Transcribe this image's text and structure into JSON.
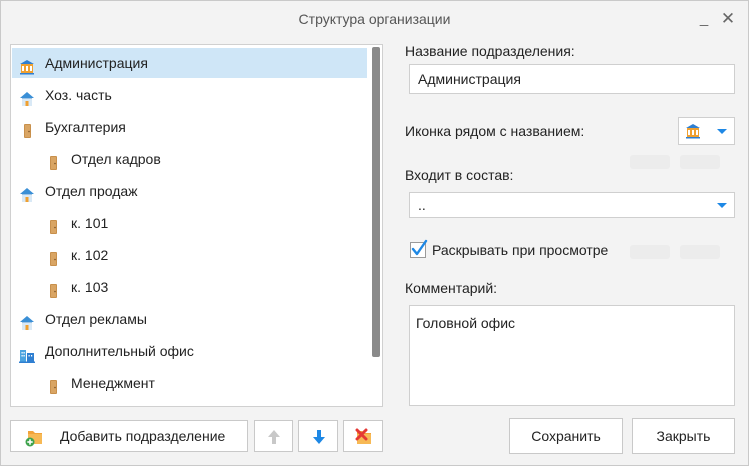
{
  "window": {
    "title": "Структура организации",
    "minimize_glyph": "_",
    "close_glyph": "✕"
  },
  "tree": {
    "items": [
      {
        "label": "Администрация",
        "icon": "building-icon",
        "level": 0,
        "selected": true
      },
      {
        "label": "Хоз. часть",
        "icon": "house-icon",
        "level": 0,
        "selected": false
      },
      {
        "label": "Бухгалтерия",
        "icon": "door-icon",
        "level": 0,
        "selected": false
      },
      {
        "label": "Отдел кадров",
        "icon": "door-icon",
        "level": 1,
        "selected": false
      },
      {
        "label": "Отдел продаж",
        "icon": "house-icon",
        "level": 0,
        "selected": false
      },
      {
        "label": "к. 101",
        "icon": "door-icon",
        "level": 1,
        "selected": false
      },
      {
        "label": "к. 102",
        "icon": "door-icon",
        "level": 1,
        "selected": false
      },
      {
        "label": "к. 103",
        "icon": "door-icon",
        "level": 1,
        "selected": false
      },
      {
        "label": "Отдел рекламы",
        "icon": "house-icon",
        "level": 0,
        "selected": false
      },
      {
        "label": "Дополнительный офис",
        "icon": "office-towers-icon",
        "level": 0,
        "selected": false
      },
      {
        "label": "Менеджмент",
        "icon": "door-icon",
        "level": 1,
        "selected": false
      }
    ]
  },
  "form": {
    "name_label": "Название подразделения:",
    "name_value": "Администрация",
    "icon_label": "Иконка рядом с названием:",
    "icon_value": "building-icon",
    "parent_label": "Входит в состав:",
    "parent_value": "..",
    "expand_label": "Раскрывать при просмотре",
    "expand_checked": true,
    "comment_label": "Комментарий:",
    "comment_value": "Головной офис"
  },
  "buttons": {
    "add_label": "Добавить подразделение",
    "save_label": "Сохранить",
    "close_label": "Закрыть"
  },
  "colors": {
    "accent": "#1e88e5",
    "selection": "#cfe6f7"
  }
}
